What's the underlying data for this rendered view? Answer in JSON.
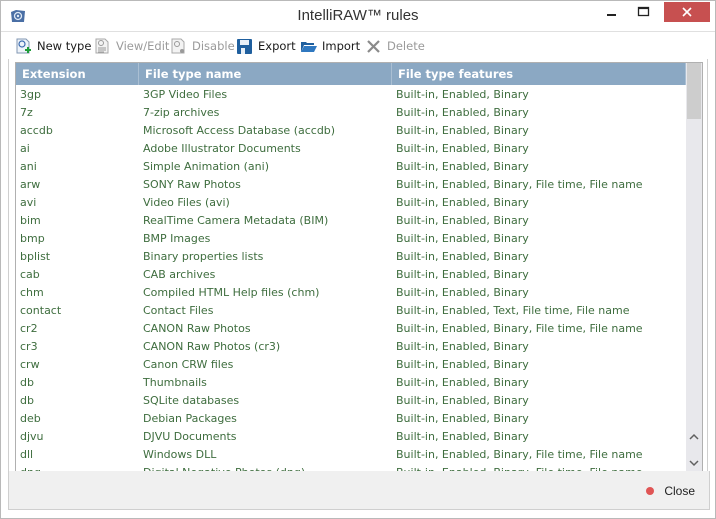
{
  "window": {
    "title": "IntelliRAW™ rules",
    "controls": {
      "minimize": "minimize",
      "maximize": "maximize",
      "close": "×"
    }
  },
  "toolbar": {
    "new_type": "New type",
    "view_edit": "View/Edit",
    "disable": "Disable",
    "export": "Export",
    "import": "Import",
    "delete": "Delete"
  },
  "table": {
    "columns": [
      "Extension",
      "File type name",
      "File type features"
    ],
    "rows": [
      {
        "ext": "3gp",
        "name": "3GP Video Files",
        "features": "Built-in, Enabled, Binary"
      },
      {
        "ext": "7z",
        "name": "7-zip archives",
        "features": "Built-in, Enabled, Binary"
      },
      {
        "ext": "accdb",
        "name": "Microsoft Access Database (accdb)",
        "features": "Built-in, Enabled, Binary"
      },
      {
        "ext": "ai",
        "name": "Adobe Illustrator Documents",
        "features": "Built-in, Enabled, Binary"
      },
      {
        "ext": "ani",
        "name": "Simple Animation (ani)",
        "features": "Built-in, Enabled, Binary"
      },
      {
        "ext": "arw",
        "name": "SONY Raw Photos",
        "features": "Built-in, Enabled, Binary, File time, File name"
      },
      {
        "ext": "avi",
        "name": "Video Files (avi)",
        "features": "Built-in, Enabled, Binary"
      },
      {
        "ext": "bim",
        "name": "RealTime Camera Metadata (BIM)",
        "features": "Built-in, Enabled, Binary"
      },
      {
        "ext": "bmp",
        "name": "BMP Images",
        "features": "Built-in, Enabled, Binary"
      },
      {
        "ext": "bplist",
        "name": "Binary properties lists",
        "features": "Built-in, Enabled, Binary"
      },
      {
        "ext": "cab",
        "name": "CAB archives",
        "features": "Built-in, Enabled, Binary"
      },
      {
        "ext": "chm",
        "name": "Compiled HTML Help files (chm)",
        "features": "Built-in, Enabled, Binary"
      },
      {
        "ext": "contact",
        "name": "Contact Files",
        "features": "Built-in, Enabled, Text, File time, File name"
      },
      {
        "ext": "cr2",
        "name": "CANON Raw Photos",
        "features": "Built-in, Enabled, Binary, File time, File name"
      },
      {
        "ext": "cr3",
        "name": "CANON Raw Photos (cr3)",
        "features": "Built-in, Enabled, Binary"
      },
      {
        "ext": "crw",
        "name": "Canon CRW files",
        "features": "Built-in, Enabled, Binary"
      },
      {
        "ext": "db",
        "name": "Thumbnails",
        "features": "Built-in, Enabled, Binary"
      },
      {
        "ext": "db",
        "name": "SQLite databases",
        "features": "Built-in, Enabled, Binary"
      },
      {
        "ext": "deb",
        "name": "Debian Packages",
        "features": "Built-in, Enabled, Binary"
      },
      {
        "ext": "djvu",
        "name": "DJVU Documents",
        "features": "Built-in, Enabled, Binary"
      },
      {
        "ext": "dll",
        "name": "Windows DLL",
        "features": "Built-in, Enabled, Binary, File time, File name"
      },
      {
        "ext": "dng",
        "name": "Digital Negative Photos (dng)",
        "features": "Built-in, Enabled, Binary, File time, File name"
      }
    ]
  },
  "scrollbar": {
    "up": "^",
    "down": "v"
  },
  "footer": {
    "close": "Close"
  },
  "colors": {
    "header_bg": "#8ba8c3",
    "row_text": "#3e6d3e",
    "close_button": "#c75050",
    "close_dot": "#e05555"
  }
}
